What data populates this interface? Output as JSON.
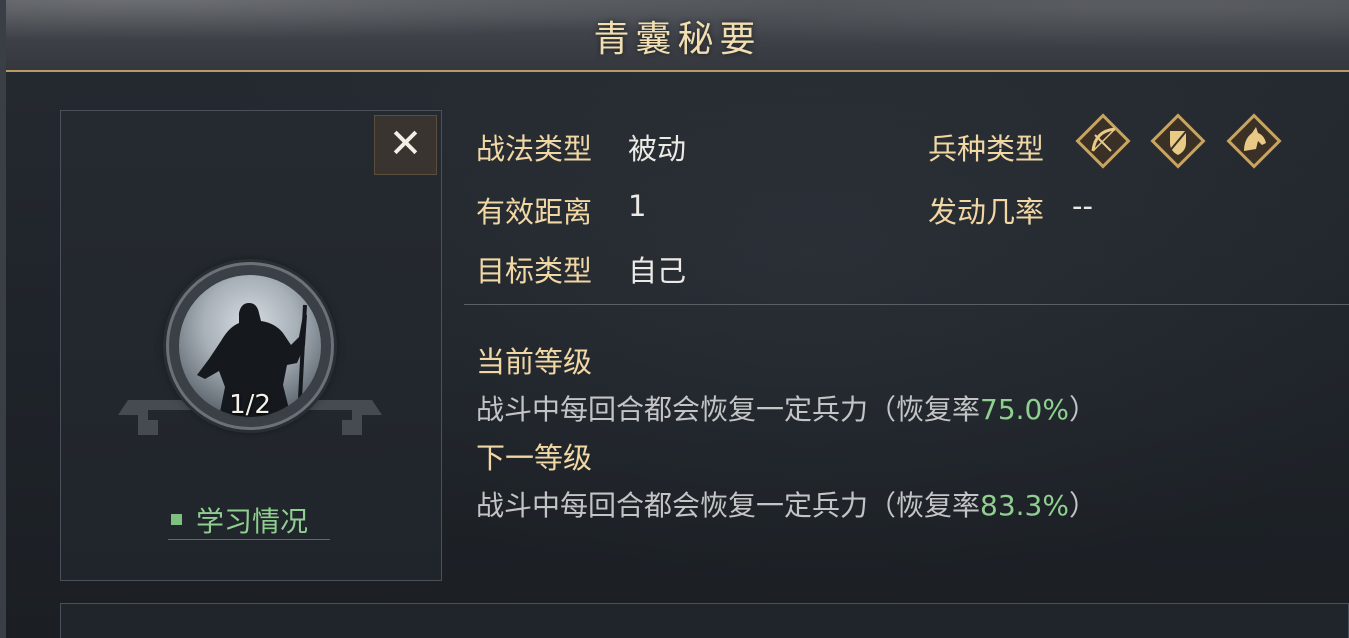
{
  "header": {
    "title": "青囊秘要"
  },
  "left_panel": {
    "close_symbol": "✕",
    "level": "1/2",
    "study_status_label": "学习情况"
  },
  "info": {
    "tactic_type_label": "战法类型",
    "tactic_type_value": "被动",
    "range_label": "有效距离",
    "range_value": "1",
    "target_label": "目标类型",
    "target_value": "自己",
    "troop_type_label": "兵种类型",
    "troop_icons": [
      "bow-icon",
      "shield-icon",
      "horse-icon"
    ],
    "trigger_label": "发动几率",
    "trigger_value": "--"
  },
  "levels": {
    "current_label": "当前等级",
    "current_desc_prefix": "战斗中每回合都会恢复一定兵力（恢复率",
    "current_pct": "75.0%",
    "current_desc_suffix": "）",
    "next_label": "下一等级",
    "next_desc_prefix": "战斗中每回合都会恢复一定兵力（恢复率",
    "next_pct": "83.3%",
    "next_desc_suffix": "）"
  },
  "colors": {
    "gold_label": "#f0d7a4",
    "highlight_green": "#8fcf8f",
    "title_gold": "#f1deb1"
  }
}
